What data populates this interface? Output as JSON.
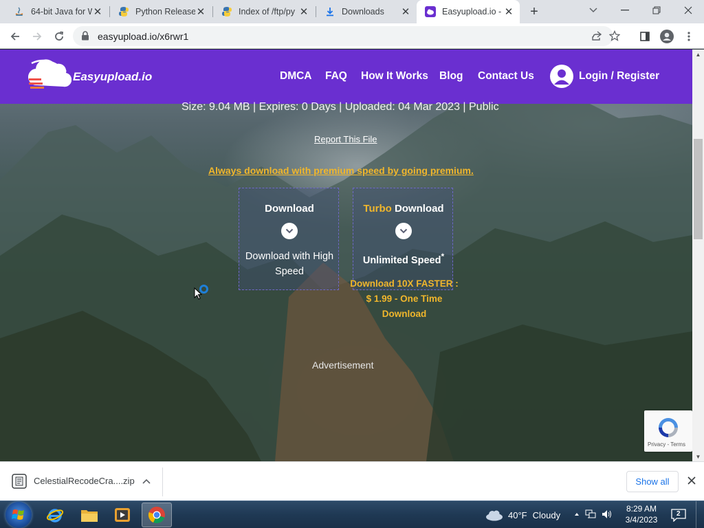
{
  "browser": {
    "tabs": [
      {
        "title": "64-bit Java for W",
        "icon": "java-icon",
        "active": false
      },
      {
        "title": "Python Release",
        "icon": "python-icon",
        "active": false
      },
      {
        "title": "Index of /ftp/py",
        "icon": "python-icon",
        "active": false
      },
      {
        "title": "Downloads",
        "icon": "download-icon",
        "active": false
      },
      {
        "title": "Easyupload.io -",
        "icon": "easyupload-icon",
        "active": true
      }
    ],
    "url": "easyupload.io/x6rwr1"
  },
  "site": {
    "brand": "Easyupload.io",
    "nav": [
      "DMCA",
      "FAQ",
      "How It Works",
      "Blog",
      "Contact Us"
    ],
    "login": "Login / Register"
  },
  "file": {
    "meta": "Size: 9.04 MB | Expires: 0 Days | Uploaded: 04 Mar 2023 | Public",
    "report": "Report This File",
    "premium_link": "Always download with premium speed by going premium."
  },
  "cards": {
    "free": {
      "title": "Download",
      "subtitle": "Download with High Speed"
    },
    "turbo": {
      "title_accent": "Turbo",
      "title": "Download",
      "subtitle": "Unlimited Speed",
      "marker": "*"
    }
  },
  "turbo_offer": {
    "line1": "Download 10X FASTER :",
    "line2": "$ 1.99 - One Time",
    "line3": "Download"
  },
  "advertisement": "Advertisement",
  "recaptcha": {
    "links": "Privacy - Terms"
  },
  "download_shelf": {
    "filename": "CelestialRecodeCra....zip",
    "show_all": "Show all"
  },
  "taskbar": {
    "weather": {
      "temp": "40°F",
      "condition": "Cloudy"
    },
    "clock": {
      "time": "8:29 AM",
      "date": "3/4/2023"
    },
    "notifications": "2"
  },
  "colors": {
    "header_purple": "#6a2fd0",
    "accent_gold": "#f0b62c",
    "link_blue": "#1a73e8"
  }
}
